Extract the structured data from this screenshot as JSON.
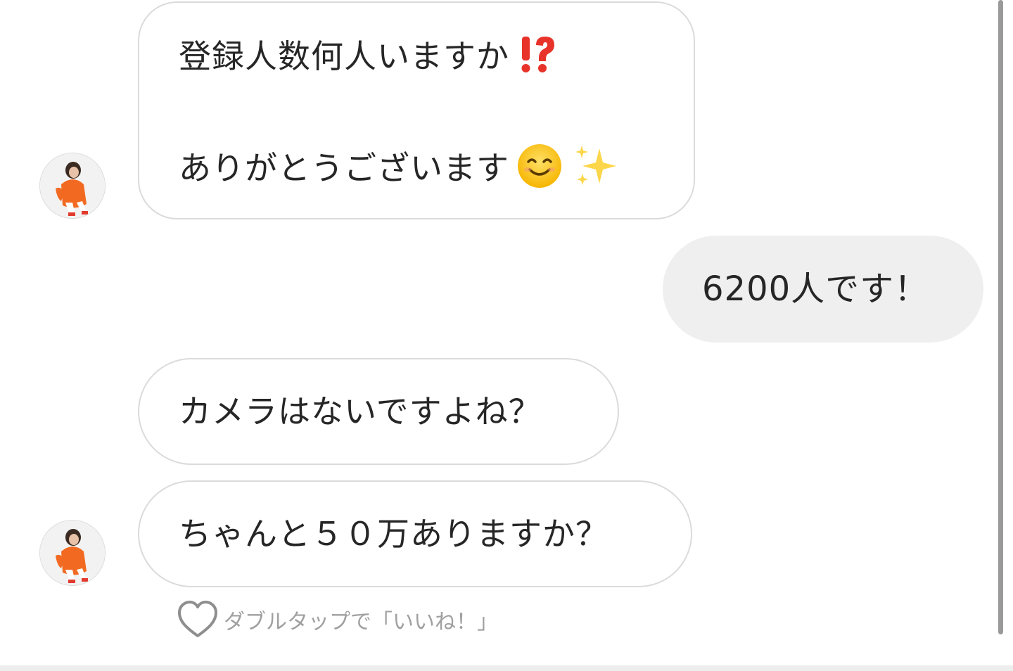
{
  "messages": [
    {
      "line1": "登録人数何人いますか",
      "line2": "ありがとうございます"
    },
    {
      "text": "6200人です！"
    },
    {
      "text": "カメラはないですよね？"
    },
    {
      "text": "ちゃんと５０万ありますか？"
    }
  ],
  "like_hint": "ダブルタップで「いいね！」",
  "icons": {
    "exclamation_question": "exclamation-question-icon",
    "smile": "smiling-face-icon",
    "sparkles": "sparkles-icon",
    "heart": "heart-outline-icon"
  },
  "colors": {
    "incoming_bg": "#ffffff",
    "incoming_border": "#dbdbdb",
    "outgoing_bg": "#efefef",
    "text": "#262626",
    "hint": "#a0a0a0",
    "accent_red": "#e8332a"
  }
}
